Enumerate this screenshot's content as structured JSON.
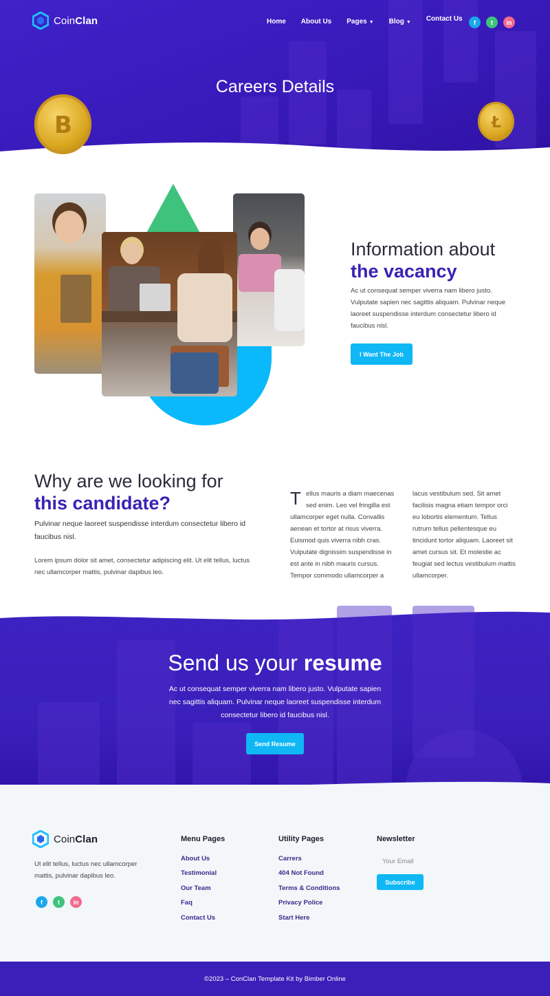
{
  "brand": {
    "name_light": "Coin",
    "name_bold": "Clan"
  },
  "nav": {
    "home": "Home",
    "about": "About Us",
    "pages": "Pages",
    "blog": "Blog",
    "contact": "Contact Us"
  },
  "social": {
    "facebook": "f",
    "twitter": "t",
    "linkedin": "in"
  },
  "hero": {
    "title": "Careers Details"
  },
  "info": {
    "title_light": "Information about",
    "title_bold": "the vacancy",
    "text": "Ac ut consequat semper viverra nam libero justo. Vulputate sapien nec sagittis aliquam. Pulvinar neque laoreet suspendisse interdum consectetur libero id faucibus nisl.",
    "button": "I Want The Job"
  },
  "why": {
    "title_light": "Why are we looking for",
    "title_bold": "this candidate?",
    "lead": "Pulvinar neque laoreet suspendisse interdum consectetur libero id faucibus nisl.",
    "body": "Lorem ipsum dolor sit amet, consectetur adipiscing elit. Ut elit tellus, luctus nec ullamcorper mattis, pulvinar dapibus leo.",
    "dropcap": "T",
    "col1_first": "ellus mauris a diam maecenas sed enim. Leo vel fringilla est",
    "col1_rest": "ullamcorper eget nulla. Convallis aenean et tortor at risus viverra. Euismod quis viverra nibh cras. Vulputate dignissim suspendisse in est ante in nibh mauris cursus. Tempor commodo ullamcorper a",
    "col2": "lacus vestibulum sed. Sit amet facilisis magna etiam tempor orci eu lobortis elementum. Tellus rutrum tellus pellentesque eu tincidunt tortor aliquam. Laoreet sit amet cursus sit. Et molestie ac feugiat sed lectus vestibulum mattis ullamcorper."
  },
  "resume": {
    "title_light": "Send us your",
    "title_bold": "resume",
    "text": "Ac ut consequat semper viverra nam libero justo. Vulputate sapien nec sagittis aliquam. Pulvinar neque laoreet suspendisse interdum consectetur libero id faucibus nisl.",
    "button": "Send Resume"
  },
  "footer": {
    "about": "Ut elit tellus, luctus nec ullamcorper mattis, pulvinar dapibus leo.",
    "menu_title": "Menu Pages",
    "menu": [
      "About Us",
      "Testimonial",
      "Our Team",
      "Faq",
      "Contact Us"
    ],
    "utility_title": "Utility Pages",
    "utility": [
      "Carrers",
      "404 Not Found",
      "Terms & Conditions",
      "Privacy Police",
      "Start Here"
    ],
    "newsletter_title": "Newsletter",
    "email_placeholder": "Your Email",
    "subscribe": "Subscribe",
    "copyright": "©2023 – ConClan Template Kit by Bimber Online"
  },
  "colors": {
    "primary": "#3a1fb8",
    "accent": "#0fb7f5",
    "green": "#3fc37c",
    "pink": "#f06a8f",
    "gold": "#e6b52e"
  }
}
